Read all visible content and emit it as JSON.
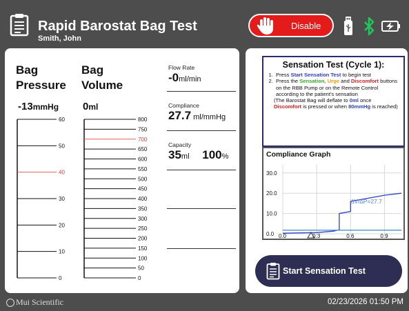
{
  "header": {
    "title": "Rapid Barostat Bag Test",
    "subtitle": "Smith, John",
    "disable_label": "Disable",
    "icons": [
      "clipboard-icon",
      "hand-stop-icon",
      "usb-icon",
      "bluetooth-icon",
      "battery-charging-icon"
    ]
  },
  "pressure": {
    "title_line1": "Bag",
    "title_line2": "Pressure",
    "value": "-13",
    "unit": "mmHg",
    "ticks": [
      "60",
      "50",
      "40",
      "30",
      "20",
      "10",
      "0"
    ],
    "highlight_tick": "40"
  },
  "volume": {
    "title_line1": "Bag",
    "title_line2": "Volume",
    "value": "0",
    "unit": "ml",
    "ticks": [
      "800",
      "750",
      "700",
      "650",
      "600",
      "550",
      "500",
      "450",
      "400",
      "350",
      "300",
      "250",
      "200",
      "150",
      "100",
      "50",
      "0"
    ],
    "highlight_tick": "700"
  },
  "flow": {
    "label": "Flow Rate",
    "value": "-0",
    "unit": "ml/min"
  },
  "compliance": {
    "label": "Compliance",
    "value": "27.7",
    "unit": "ml/mmHg"
  },
  "capacity": {
    "label": "Capacity",
    "value": "35",
    "unit": "ml",
    "percent": "100",
    "percent_unit": "%"
  },
  "sensation": {
    "title": "Sensation Test (Cycle 1):",
    "step1_a": "Press ",
    "step1_b": "Start Sensation Test",
    "step1_c": " to begin test",
    "step2_a": "Press the ",
    "step2_b": "Sensation",
    "step2_c": ", ",
    "step2_d": "Urge",
    "step2_e": " and ",
    "step2_f": "Discomfort",
    "step2_g": " buttons on the RBB Pump or on the Remote Control according to the patient's sensation",
    "note_a": "(The Barostat Bag will deflate to ",
    "note_b": "0ml",
    "note_c": " once ",
    "note_d": "Discomfort",
    "note_e": " is pressed or when ",
    "note_f": "80mmHg",
    "note_g": " is reached)"
  },
  "graph": {
    "title": "Compliance Graph",
    "annotation": "∆V/∆P=27.7"
  },
  "chart_data": {
    "type": "line",
    "title": "Compliance Graph",
    "xlabel": "",
    "ylabel": "",
    "xlim": [
      0.0,
      1.05
    ],
    "ylim": [
      -1,
      34
    ],
    "x_ticks": [
      "0.0",
      "0.3",
      "0.6",
      "0.9"
    ],
    "y_ticks": [
      "0.0",
      "10.0",
      "20.0",
      "30.0"
    ],
    "grid": true,
    "series": [
      {
        "points": [
          [
            0.0,
            0.3
          ],
          [
            0.3,
            0.6
          ],
          [
            0.45,
            1.3
          ],
          [
            0.5,
            2.0
          ],
          [
            0.5,
            10.0
          ],
          [
            0.6,
            11.0
          ],
          [
            0.6,
            16.0
          ],
          [
            0.75,
            17.5
          ],
          [
            0.9,
            19.0
          ],
          [
            1.05,
            20.0
          ]
        ],
        "color": "#2e3fbf"
      },
      {
        "points": [
          [
            0.0,
            1.8
          ],
          [
            1.05,
            1.8
          ]
        ],
        "color": "#4a8fd6"
      }
    ],
    "marker": {
      "shape": "triangle",
      "x": 0.25
    }
  },
  "start_button": {
    "label": "Start Sensation Test"
  },
  "footer": {
    "brand": "Mui Scientific",
    "datetime": "02/23/2026 01:50 PM"
  },
  "colors": {
    "background": "#4d4d4d",
    "disable": "#e31b1b",
    "start_button": "#2e2d53",
    "highlight": "#e06060"
  }
}
